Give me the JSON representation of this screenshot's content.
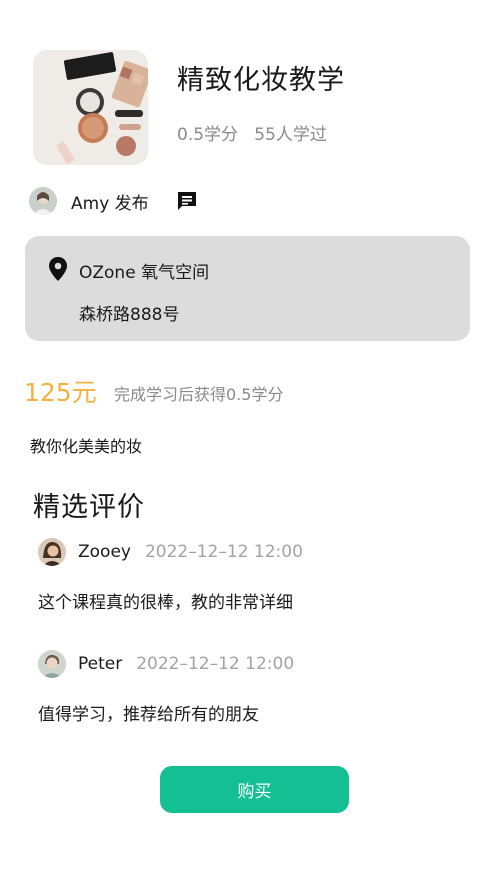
{
  "course": {
    "title": "精致化妆教学",
    "meta": "0.5学分   55人学过"
  },
  "publisher": {
    "name": "Amy 发布",
    "chat_icon": "chat-bubble-icon"
  },
  "location": {
    "icon": "location-pin-icon",
    "name": "OZone 氧气空间",
    "address": "森桥路888号"
  },
  "price": {
    "amount": "125元",
    "note": "完成学习后获得0.5学分"
  },
  "description": "教你化美美的妆",
  "reviews": {
    "title": "精选评价",
    "items": [
      {
        "name": "Zooey",
        "time": "2022–12–12 12:00",
        "text": "这个课程真的很棒，教的非常详细"
      },
      {
        "name": "Peter",
        "time": "2022–12–12 12:00",
        "text": "值得学习，推荐给所有的朋友"
      }
    ]
  },
  "actions": {
    "buy_label": "购买"
  },
  "colors": {
    "accent": "#15bf94",
    "price": "#f3b23f",
    "card": "#dcdcdc",
    "muted": "#8a8a8a"
  }
}
